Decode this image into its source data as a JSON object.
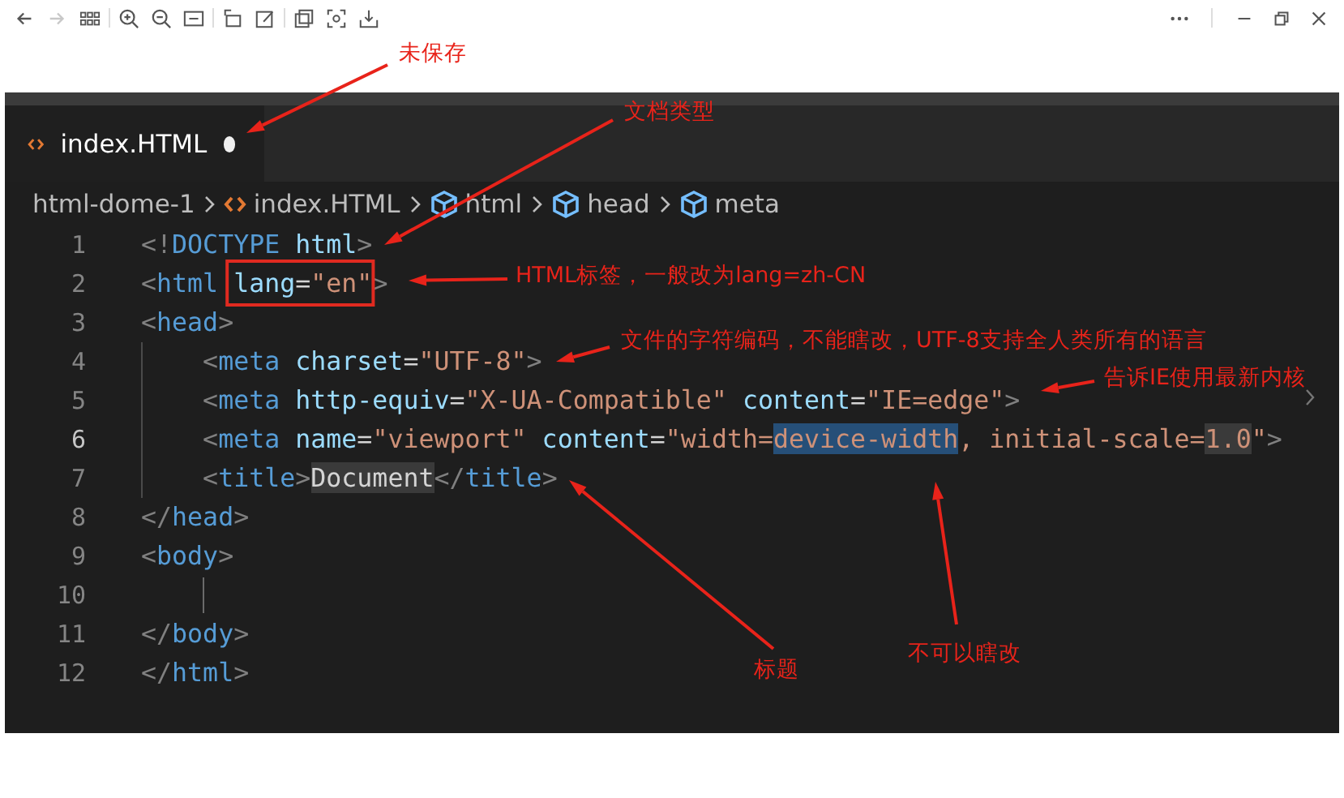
{
  "toolbar": [
    {
      "kind": "back",
      "disabled": false
    },
    {
      "kind": "forward",
      "disabled": true
    },
    {
      "kind": "grid",
      "disabled": false
    },
    {
      "kind": "zoom-in",
      "disabled": false
    },
    {
      "kind": "zoom-out",
      "disabled": false
    },
    {
      "kind": "fit",
      "disabled": false
    },
    {
      "kind": "rotate",
      "disabled": false
    },
    {
      "kind": "edit",
      "disabled": false
    },
    {
      "kind": "copy",
      "disabled": false
    },
    {
      "kind": "select",
      "disabled": false
    },
    {
      "kind": "save",
      "disabled": false
    }
  ],
  "window_controls": [
    {
      "kind": "more"
    },
    {
      "kind": "minimize"
    },
    {
      "kind": "restore"
    },
    {
      "kind": "close"
    }
  ],
  "tab": {
    "label": "index.HTML",
    "modified": true,
    "selected": true
  },
  "breadcrumb": [
    {
      "kind": "folder",
      "label": "html-dome-1"
    },
    {
      "kind": "file",
      "label": "index.HTML"
    },
    {
      "kind": "symbol",
      "label": "html"
    },
    {
      "kind": "symbol",
      "label": "head"
    },
    {
      "kind": "symbol",
      "label": "meta"
    }
  ],
  "lines": [
    {
      "number": "1",
      "active": false,
      "cursor": false,
      "tokens": [
        {
          "kind": "punct",
          "text": "<!"
        },
        {
          "kind": "tag",
          "text": "DOCTYPE"
        },
        {
          "kind": "attr",
          "text": " html"
        },
        {
          "kind": "punct",
          "text": ">"
        }
      ]
    },
    {
      "number": "2",
      "active": false,
      "cursor": false,
      "tokens": [
        {
          "kind": "punct",
          "text": "<"
        },
        {
          "kind": "tag",
          "text": "html "
        },
        {
          "kind": "attr",
          "text": "lang",
          "boxed": true
        },
        {
          "kind": "text",
          "text": "=",
          "boxed": true
        },
        {
          "kind": "string",
          "text": "\"en\"",
          "boxed": true
        },
        {
          "kind": "punct",
          "text": ">"
        }
      ]
    },
    {
      "number": "3",
      "active": false,
      "cursor": false,
      "tokens": [
        {
          "kind": "punct",
          "text": "<"
        },
        {
          "kind": "tag",
          "text": "head"
        },
        {
          "kind": "punct",
          "text": ">"
        }
      ]
    },
    {
      "number": "4",
      "active": false,
      "cursor": false,
      "tokens": [
        {
          "kind": "punct",
          "text": "    <"
        },
        {
          "kind": "tag",
          "text": "meta"
        },
        {
          "kind": "attr",
          "text": " charset"
        },
        {
          "kind": "text",
          "text": "="
        },
        {
          "kind": "string",
          "text": "\"UTF-8\""
        },
        {
          "kind": "punct",
          "text": ">"
        }
      ]
    },
    {
      "number": "5",
      "active": false,
      "cursor": false,
      "tokens": [
        {
          "kind": "punct",
          "text": "    <"
        },
        {
          "kind": "tag",
          "text": "meta"
        },
        {
          "kind": "attr",
          "text": " http-equiv"
        },
        {
          "kind": "text",
          "text": "="
        },
        {
          "kind": "string",
          "text": "\"X-UA-Compatible\""
        },
        {
          "kind": "attr",
          "text": " content"
        },
        {
          "kind": "text",
          "text": "="
        },
        {
          "kind": "string",
          "text": "\"IE=edge\""
        },
        {
          "kind": "punct",
          "text": ">"
        }
      ]
    },
    {
      "number": "6",
      "active": true,
      "cursor": false,
      "tokens": [
        {
          "kind": "punct",
          "text": "    <"
        },
        {
          "kind": "tag",
          "text": "meta"
        },
        {
          "kind": "attr",
          "text": " name"
        },
        {
          "kind": "text",
          "text": "="
        },
        {
          "kind": "string",
          "text": "\"viewport\""
        },
        {
          "kind": "attr",
          "text": " content"
        },
        {
          "kind": "text",
          "text": "="
        },
        {
          "kind": "string",
          "text": "\"width="
        },
        {
          "kind": "string",
          "text": "device-width",
          "selected": true
        },
        {
          "kind": "string",
          "text": ", initial-scale="
        },
        {
          "kind": "string",
          "text": "1.0",
          "marked": true
        },
        {
          "kind": "string",
          "text": "\""
        },
        {
          "kind": "punct",
          "text": ">"
        }
      ]
    },
    {
      "number": "7",
      "active": false,
      "cursor": false,
      "tokens": [
        {
          "kind": "punct",
          "text": "    <"
        },
        {
          "kind": "tag",
          "text": "title"
        },
        {
          "kind": "punct",
          "text": ">"
        },
        {
          "kind": "text",
          "text": "Document",
          "marked": true
        },
        {
          "kind": "punct",
          "text": "</"
        },
        {
          "kind": "tag",
          "text": "title"
        },
        {
          "kind": "punct",
          "text": ">"
        }
      ]
    },
    {
      "number": "8",
      "active": false,
      "cursor": false,
      "tokens": [
        {
          "kind": "punct",
          "text": "</"
        },
        {
          "kind": "tag",
          "text": "head"
        },
        {
          "kind": "punct",
          "text": ">"
        }
      ]
    },
    {
      "number": "9",
      "active": false,
      "cursor": false,
      "tokens": [
        {
          "kind": "punct",
          "text": "<"
        },
        {
          "kind": "tag",
          "text": "body"
        },
        {
          "kind": "punct",
          "text": ">"
        }
      ]
    },
    {
      "number": "10",
      "active": false,
      "cursor": true
    },
    {
      "number": "11",
      "active": false,
      "cursor": false,
      "tokens": [
        {
          "kind": "punct",
          "text": "</"
        },
        {
          "kind": "tag",
          "text": "body"
        },
        {
          "kind": "punct",
          "text": ">"
        }
      ]
    },
    {
      "number": "12",
      "active": false,
      "cursor": false,
      "tokens": [
        {
          "kind": "punct",
          "text": "</"
        },
        {
          "kind": "tag",
          "text": "html"
        },
        {
          "kind": "punct",
          "text": ">"
        }
      ]
    }
  ],
  "annotations": [
    {
      "text": "未保存"
    },
    {
      "text": "文档类型"
    },
    {
      "text": "HTML标签，一般改为lang=zh-CN"
    },
    {
      "text": "文件的字符编码，不能瞎改，UTF-8支持全人类所有的语言"
    },
    {
      "text": "告诉IE使用最新内核"
    },
    {
      "text": "标题"
    },
    {
      "text": "不可以瞎改"
    }
  ]
}
